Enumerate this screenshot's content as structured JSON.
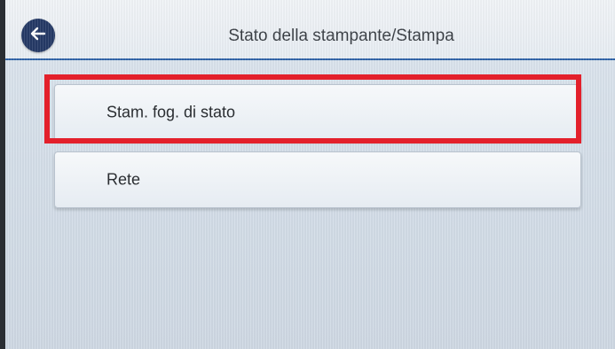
{
  "header": {
    "title": "Stato della stampante/Stampa",
    "back_icon": "arrow-left-icon"
  },
  "menu": {
    "items": [
      {
        "label": "Stam. fog. di stato"
      },
      {
        "label": "Rete"
      }
    ]
  },
  "colors": {
    "highlight": "#e3202b",
    "back_button": "#253a66",
    "header_rule": "#2f63a8"
  }
}
